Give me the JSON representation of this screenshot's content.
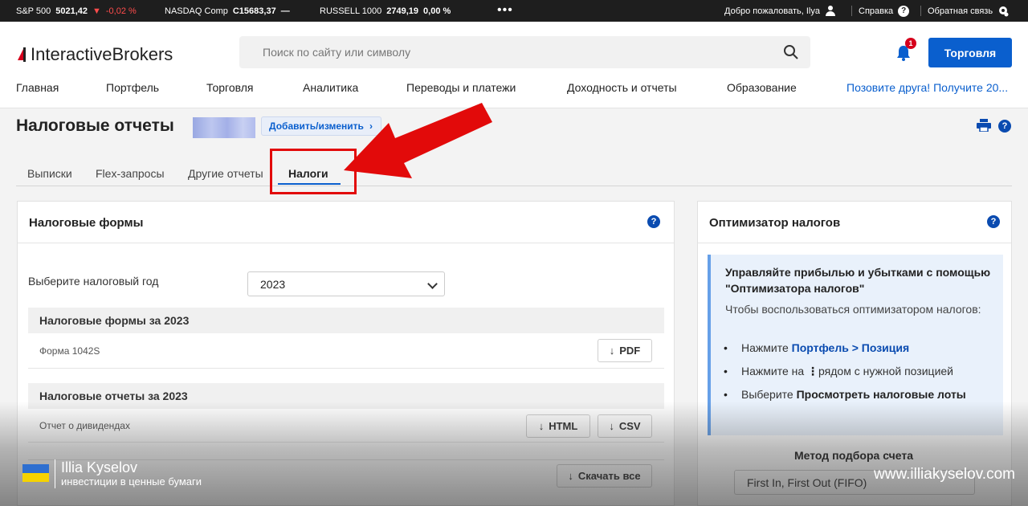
{
  "ticker": {
    "items": [
      {
        "name": "S&P 500",
        "value": "5021,42",
        "change": "-0,02 %",
        "direction": "down"
      },
      {
        "name": "NASDAQ Comp",
        "value": "C15683,37",
        "change": "—"
      },
      {
        "name": "RUSSELL 1000",
        "value": "2749,19",
        "change": "0,00 %"
      }
    ],
    "more": "•••",
    "welcome": "Добро пожаловать, Ilya",
    "help": "Справка",
    "feedback": "Обратная связь",
    "help_icon_glyph": "?"
  },
  "header": {
    "logo_part1": "Interactive",
    "logo_part2": "Brokers",
    "search_placeholder": "Поиск по сайту или символу",
    "notifications_count": "1",
    "trade_button": "Торговля",
    "nav": [
      "Главная",
      "Портфель",
      "Торговля",
      "Аналитика",
      "Переводы и платежи",
      "Доходность и отчеты",
      "Образование"
    ],
    "promo": "Позовите друга! Получите 20..."
  },
  "page": {
    "title": "Налоговые отчеты",
    "add_edit": "Добавить/изменить",
    "help_glyph": "?"
  },
  "tabs": [
    {
      "label": "Выписки",
      "active": false
    },
    {
      "label": "Flex-запросы",
      "active": false
    },
    {
      "label": "Другие отчеты",
      "active": false
    },
    {
      "label": "Налоги",
      "active": true
    }
  ],
  "tax_forms": {
    "title": "Налоговые формы",
    "year_label": "Выберите налоговый год",
    "year_value": "2023",
    "forms_section": "Налоговые формы за 2023",
    "form_row": "Форма 1042S",
    "pdf_button": "PDF",
    "reports_section": "Налоговые отчеты за 2023",
    "report_row": "Отчет о дивидендах",
    "html_button": "HTML",
    "csv_button": "CSV",
    "download_all": "Скачать все",
    "arrow_glyph": "↓"
  },
  "optimizer": {
    "title": "Оптимизатор налогов",
    "info_title": "Управляйте прибылью и убытками с помощью \"Оптимизатора налогов\"",
    "info_text": "Чтобы воспользоваться оптимизатором налогов:",
    "step1_prefix": "Нажмите ",
    "step1_link": "Портфель > Позиция",
    "step2_prefix": "Нажмите на ",
    "step2_glyph": "⋮",
    "step2_suffix": "рядом с нужной позицией",
    "step3_prefix": "Выберите ",
    "step3_bold": "Просмотреть налоговые лоты",
    "method_label": "Метод подбора счета",
    "method_value": "First In, First Out (FIFO)"
  },
  "watermark": {
    "name": "Illia Kyselov",
    "subtitle": "инвестиции в ценные бумаги",
    "url": "www.illiakyselov.com"
  },
  "colors": {
    "accent": "#0a5fce",
    "highlight_red": "#e20a0a",
    "ticker_bg": "#1e1e1e"
  }
}
